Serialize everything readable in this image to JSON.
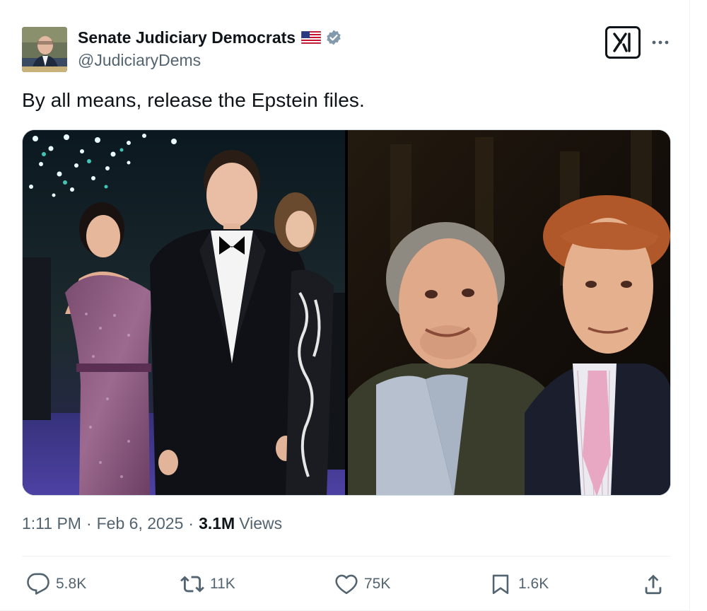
{
  "author": {
    "name": "Senate Judiciary Democrats",
    "handle": "@JudiciaryDems",
    "verified": true,
    "flag": "us-flag-icon"
  },
  "tweet": {
    "text": "By all means, release the Epstein files.",
    "time": "1:11 PM",
    "date": "Feb 6, 2025",
    "views_count": "3.1M",
    "views_label": "Views",
    "separator": "·"
  },
  "media": {
    "count": 2,
    "images": [
      "photo-gala-couple",
      "photo-two-men"
    ]
  },
  "actions": {
    "replies": "5.8K",
    "reposts": "11K",
    "likes": "75K",
    "bookmarks": "1.6K"
  },
  "colors": {
    "text": "#0f1419",
    "secondary": "#536471",
    "border": "#cfd9de",
    "verified_badge": "#829aab"
  }
}
